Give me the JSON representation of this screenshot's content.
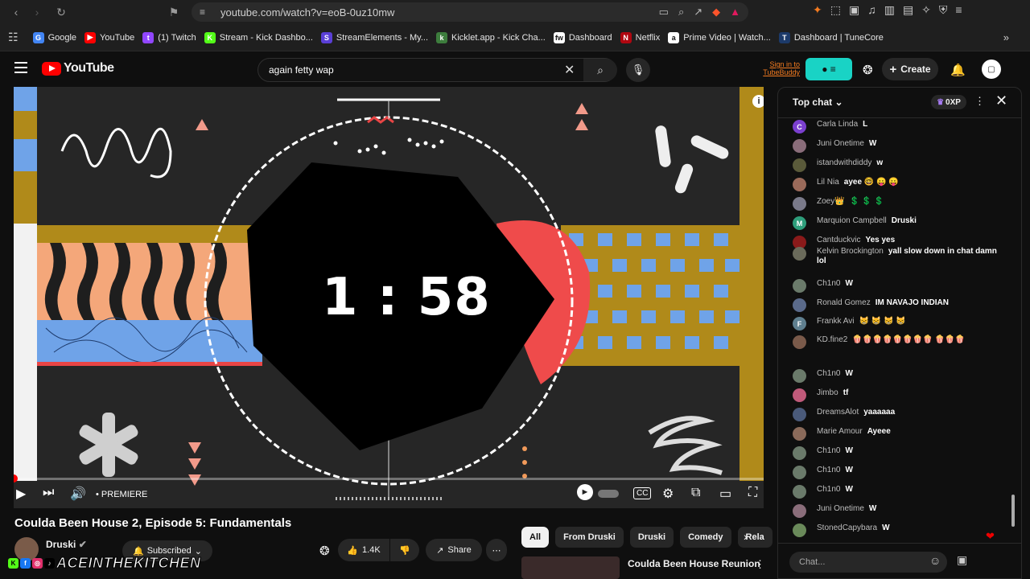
{
  "browser": {
    "url": "youtube.com/watch?v=eoB-0uz10mw",
    "bookmarks": [
      {
        "label": "Google",
        "color": "#4285f4",
        "glyph": "G"
      },
      {
        "label": "YouTube",
        "color": "#ff0000",
        "glyph": "▶"
      },
      {
        "label": "(1) Twitch",
        "color": "#9146ff",
        "glyph": "t"
      },
      {
        "label": "Stream - Kick Dashbo...",
        "color": "#53fc18",
        "glyph": "K"
      },
      {
        "label": "StreamElements - My...",
        "color": "#5a3fd6",
        "glyph": "S"
      },
      {
        "label": "Kicklet.app - Kick Cha...",
        "color": "#3d7d3d",
        "glyph": "k"
      },
      {
        "label": "Dashboard",
        "color": "#ffffff",
        "glyph": "fw"
      },
      {
        "label": "Netflix",
        "color": "#b00710",
        "glyph": "N"
      },
      {
        "label": "Prime Video | Watch...",
        "color": "#ffffff",
        "glyph": "a"
      },
      {
        "label": "Dashboard | TuneCore",
        "color": "#1c3a6a",
        "glyph": "T"
      }
    ]
  },
  "header": {
    "logo": "YouTube",
    "search_value": "again fetty wap",
    "tubebuddy": "Sign in to TubeBuddy",
    "create_label": "Create"
  },
  "player": {
    "countdown": "1 : 58",
    "premiere_label": "PREMIERE",
    "progress": 0
  },
  "video": {
    "title": "Coulda Been House 2, Episode 5: Fundamentals",
    "channel": "Druski",
    "subscribed_label": "Subscribed",
    "likes": "1.4K",
    "share_label": "Share"
  },
  "chips": [
    "All",
    "From Druski",
    "Druski",
    "Comedy",
    "Rela"
  ],
  "recommendation": {
    "title": "Coulda Been House Reunion"
  },
  "watermark": "ACEINTHEKITCHEN",
  "chat": {
    "mode": "Top chat",
    "xp": "0XP",
    "input_placeholder": "Chat...",
    "messages": [
      {
        "author": "Carla Linda",
        "text": "L",
        "color": "#7b3fcf",
        "initial": "C"
      },
      {
        "author": "Juni Onetime",
        "text": "W",
        "color": "#8a6d7a",
        "initial": ""
      },
      {
        "author": "istandwithdiddy",
        "text": "w",
        "color": "#5a5a3a",
        "initial": ""
      },
      {
        "author": "Lil Nia",
        "text": "ayee 🤓 😛 😛",
        "color": "#9a6a5a",
        "initial": ""
      },
      {
        "author": "Zoey👑",
        "text": "💲 💲 💲",
        "color": "#7a7a8a",
        "initial": ""
      },
      {
        "author": "Marquion Campbell",
        "text": "Druski",
        "color": "#2e9e7b",
        "initial": "M"
      },
      {
        "author": "Cantduckvic",
        "text": "Yes yes",
        "color": "#8a1a1a",
        "initial": ""
      },
      {
        "author": "Kelvin Brockington",
        "text": "yall slow down in chat damn lol",
        "color": "#6a6a5a",
        "initial": ""
      },
      {
        "author": "Ch1n0",
        "text": "W",
        "color": "#6a7a6a",
        "initial": ""
      },
      {
        "author": "Ronald Gomez",
        "text": "IM NAVAJO INDIAN",
        "color": "#5a6a8a",
        "initial": ""
      },
      {
        "author": "Frankk Avi",
        "text": "😸 😸 😸 😸",
        "color": "#5f7f8f",
        "initial": "F"
      },
      {
        "author": "KD.fine2",
        "text": "🍿🍿🍿🍿🍿🍿🍿🍿 🍿🍿🍿",
        "color": "#7a5a4a",
        "initial": ""
      },
      {
        "author": "Ch1n0",
        "text": "W",
        "color": "#6a7a6a",
        "initial": ""
      },
      {
        "author": "Jimbo",
        "text": "tf",
        "color": "#c05a7a",
        "initial": ""
      },
      {
        "author": "DreamsAlot",
        "text": "yaaaaaa",
        "color": "#4a5a7a",
        "initial": ""
      },
      {
        "author": "Marie Amour",
        "text": "Ayeee",
        "color": "#8a6a5a",
        "initial": ""
      },
      {
        "author": "Ch1n0",
        "text": "W",
        "color": "#6a7a6a",
        "initial": ""
      },
      {
        "author": "Ch1n0",
        "text": "W",
        "color": "#6a7a6a",
        "initial": ""
      },
      {
        "author": "Ch1n0",
        "text": "W",
        "color": "#6a7a6a",
        "initial": ""
      },
      {
        "author": "Juni Onetime",
        "text": "W",
        "color": "#8a6d7a",
        "initial": ""
      },
      {
        "author": "StonedCapybara",
        "text": "W",
        "color": "#6a8a5a",
        "initial": ""
      }
    ]
  }
}
